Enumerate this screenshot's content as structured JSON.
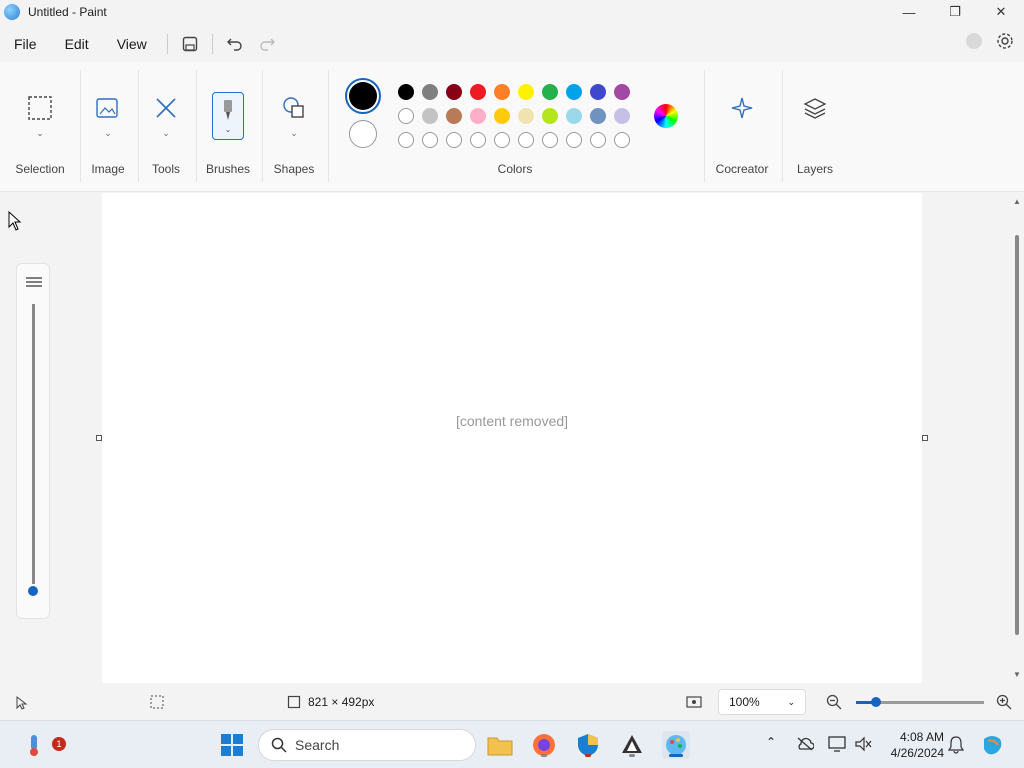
{
  "window": {
    "title": "Untitled - Paint"
  },
  "menu": {
    "items": [
      "File",
      "Edit",
      "View"
    ]
  },
  "ribbon": {
    "groups": [
      "Selection",
      "Image",
      "Tools",
      "Brushes",
      "Shapes",
      "Colors",
      "Cocreator",
      "Layers"
    ],
    "primary_color": "#000000",
    "secondary_color": "#ffffff",
    "palette_row1": [
      "#000000",
      "#7f7f7f",
      "#880015",
      "#ed1c24",
      "#ff7f27",
      "#fff200",
      "#22b14c",
      "#00a2e8",
      "#3f48cc",
      "#a349a4"
    ],
    "palette_row2": [
      "#ffffff",
      "#c3c3c3",
      "#b97a57",
      "#ffaec9",
      "#ffc90e",
      "#efe4b0",
      "#b5e61d",
      "#99d9ea",
      "#7092be",
      "#c8bfe7"
    ]
  },
  "canvas": {
    "placeholder": "[content removed]"
  },
  "status": {
    "dimensions": "821 × 492px",
    "zoom": "100%"
  },
  "taskbar": {
    "search": "Search",
    "time": "4:08 AM",
    "date": "4/26/2024",
    "badge": "1"
  }
}
